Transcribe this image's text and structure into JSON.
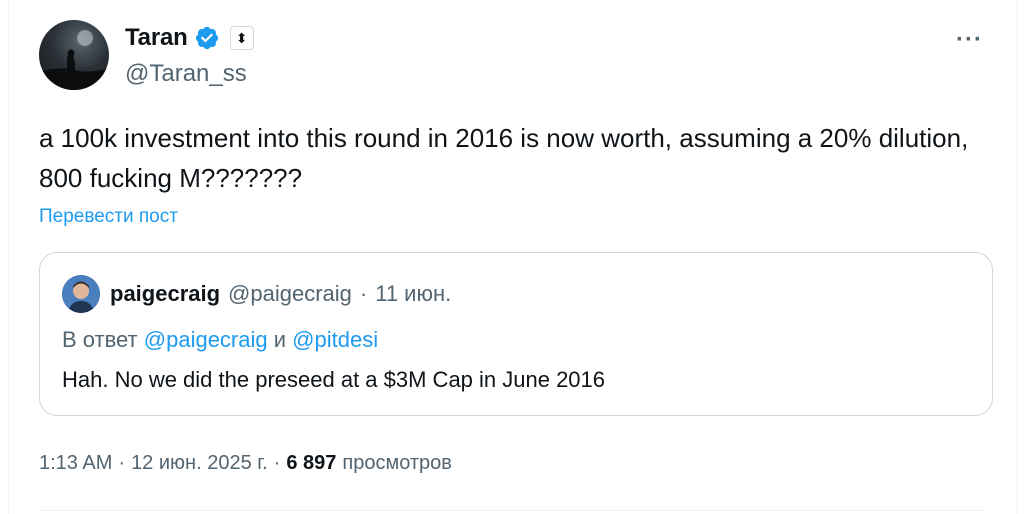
{
  "author": {
    "display_name": "Taran",
    "handle": "@Taran_ss",
    "badge_glyph": "⬍"
  },
  "tweet": {
    "text": "a 100k investment into this round in 2016 is now worth, assuming a 20% dilution, 800 fucking M???????",
    "translate_label": "Перевести пост",
    "more_label": "···"
  },
  "quote": {
    "display_name": "paigecraig",
    "handle": "@paigecraig",
    "separator": "·",
    "date": "11 июн.",
    "reply_prefix": "В ответ",
    "reply_mention_1": "@paigecraig",
    "reply_joiner": "и",
    "reply_mention_2": "@pitdesi",
    "text": "Hah. No we did the preseed at a $3M Cap in June 2016"
  },
  "footer": {
    "time": "1:13 AM",
    "sep1": "·",
    "date": "12 июн. 2025 г.",
    "sep2": "·",
    "views_count": "6 897",
    "views_label": "просмотров"
  },
  "colors": {
    "accent": "#1d9bf0",
    "text": "#0f1419",
    "secondary": "#536471",
    "border": "#cfd9de"
  },
  "icons": {
    "verified": "verified-badge-icon",
    "more": "more-options-icon",
    "affiliate": "affiliate-badge-icon"
  }
}
